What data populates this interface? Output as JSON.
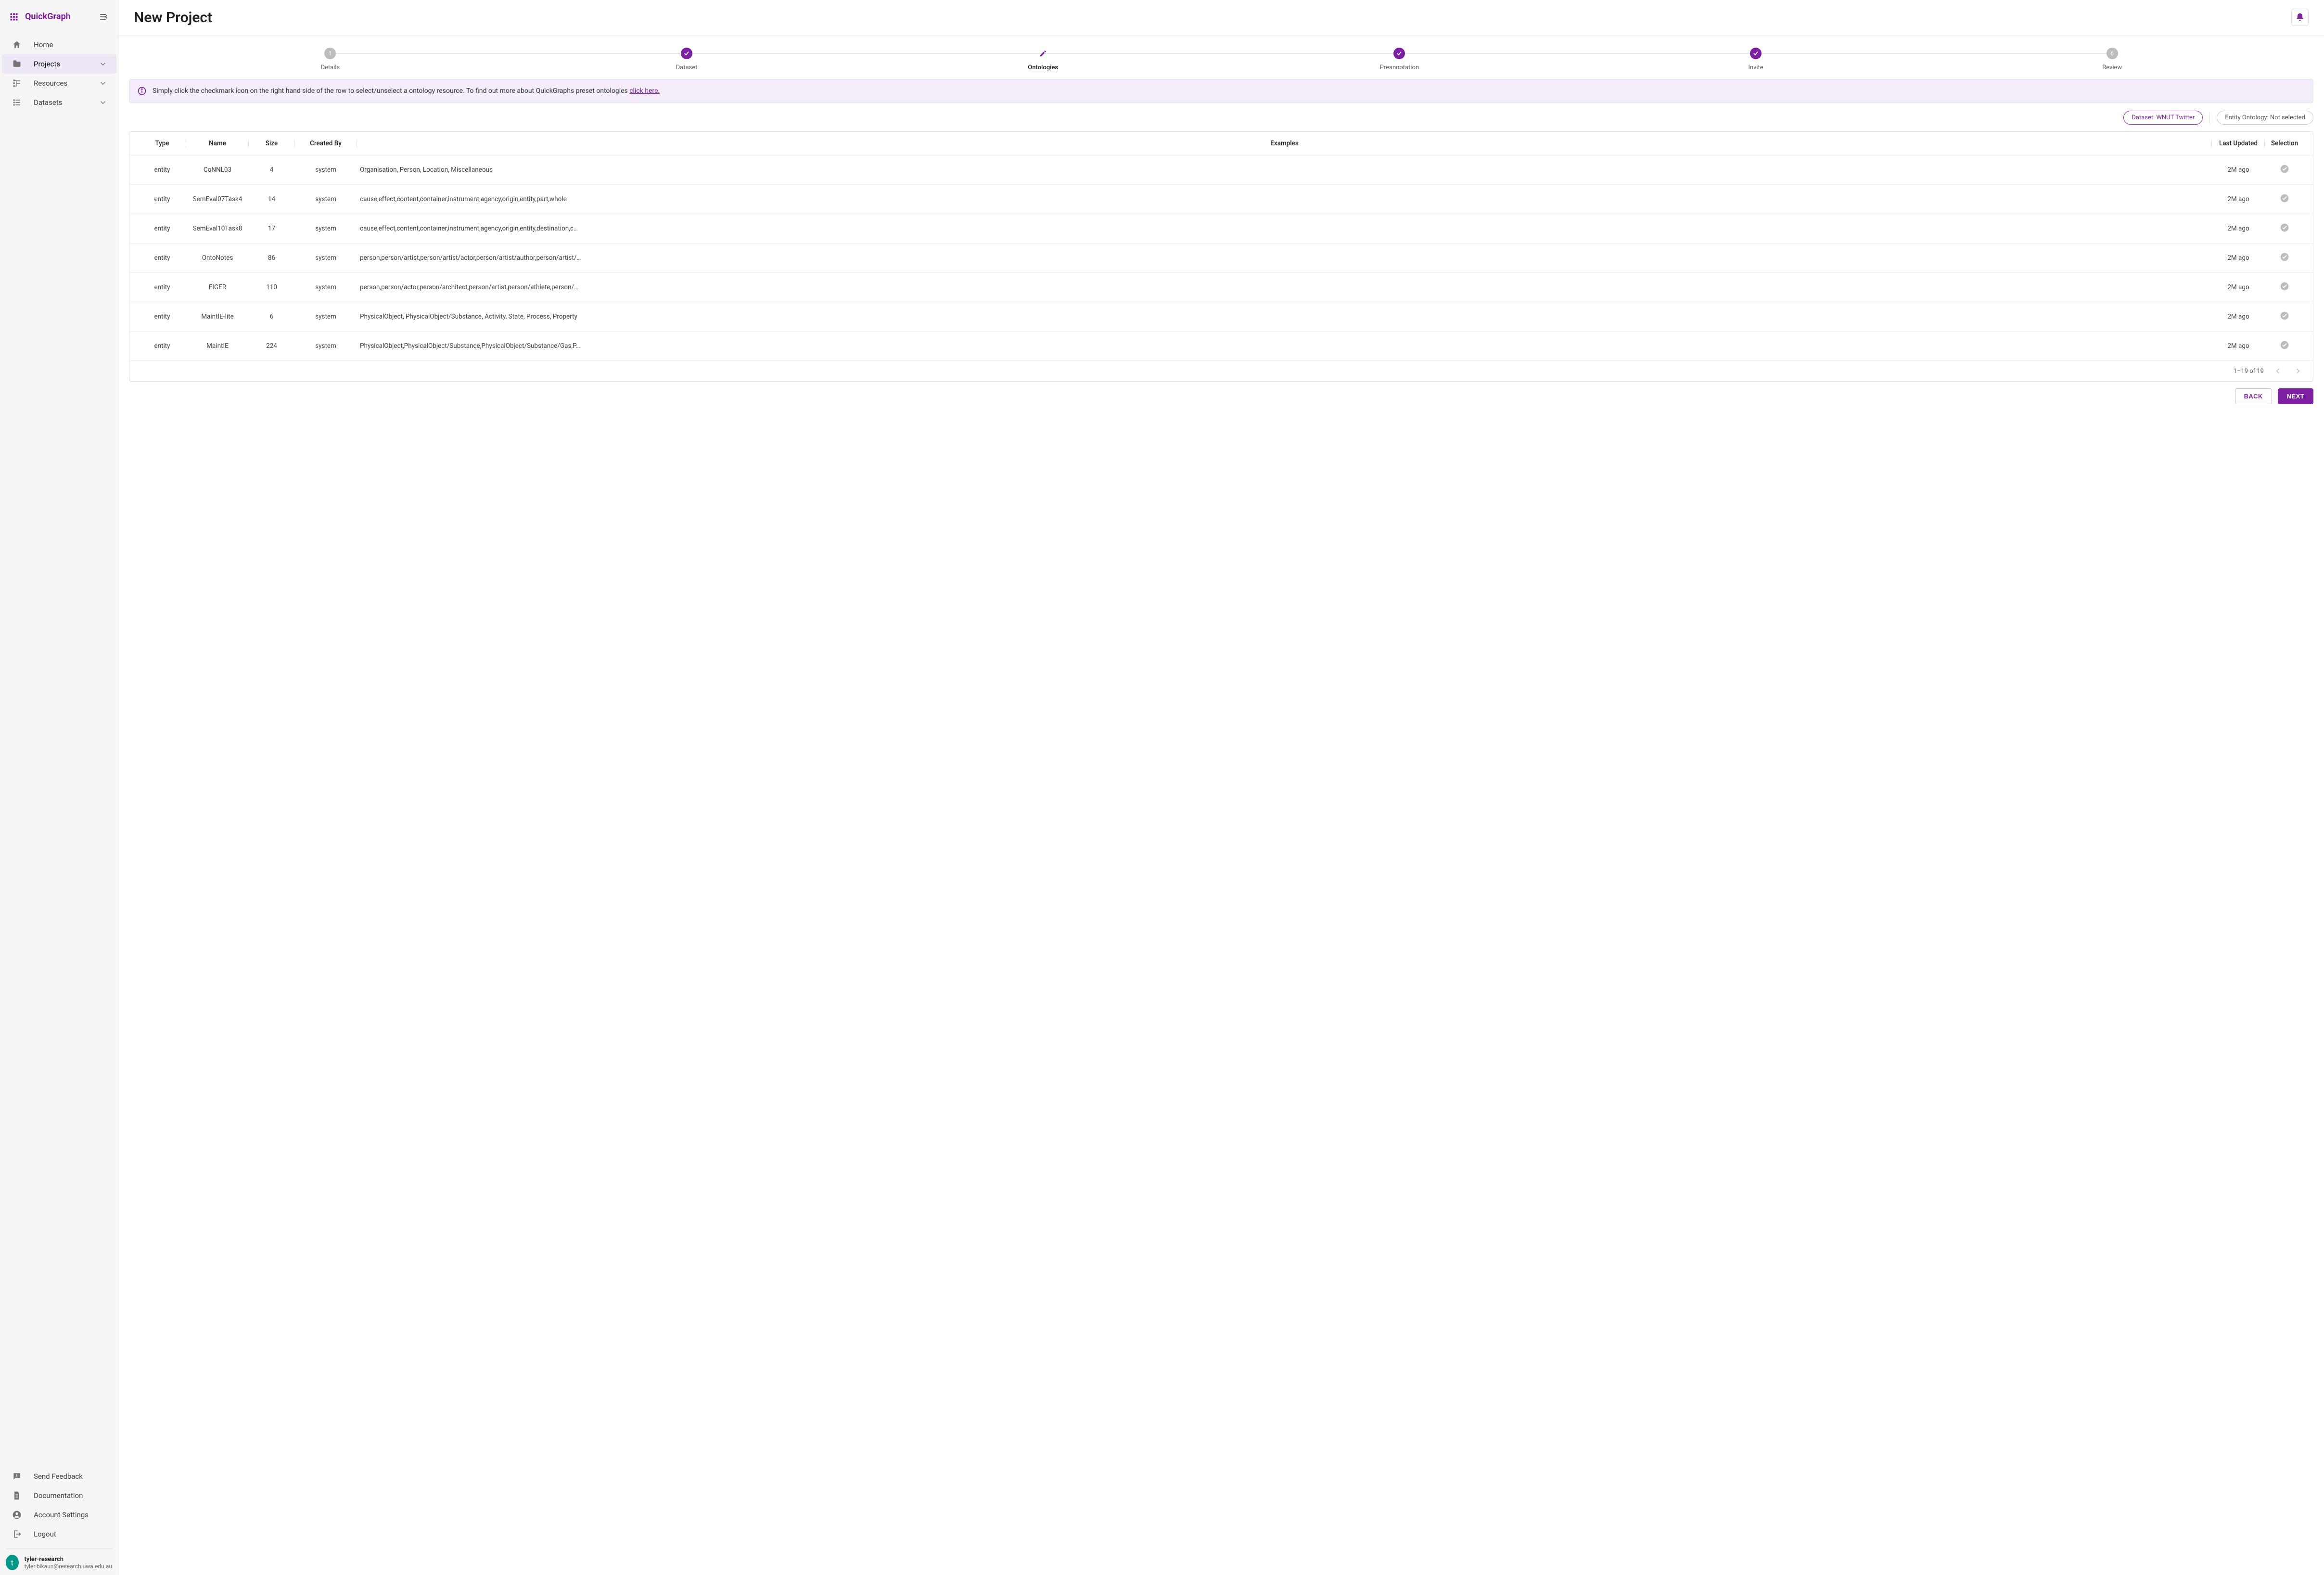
{
  "app": {
    "name": "QuickGraph"
  },
  "sidebar": {
    "items": [
      {
        "label": "Home"
      },
      {
        "label": "Projects"
      },
      {
        "label": "Resources"
      },
      {
        "label": "Datasets"
      }
    ],
    "footer": [
      {
        "label": "Send Feedback"
      },
      {
        "label": "Documentation"
      },
      {
        "label": "Account Settings"
      },
      {
        "label": "Logout"
      }
    ]
  },
  "user": {
    "initial": "t",
    "name": "tyler-research",
    "email": "tyler.bikaun@research.uwa.edu.au"
  },
  "page": {
    "title": "New Project"
  },
  "stepper": [
    {
      "label": "Details",
      "badge": "1"
    },
    {
      "label": "Dataset"
    },
    {
      "label": "Ontologies"
    },
    {
      "label": "Preannotation"
    },
    {
      "label": "Invite"
    },
    {
      "label": "Review",
      "badge": "6"
    }
  ],
  "banner": {
    "text": "Simply click the checkmark icon on the right hand side of the row to select/unselect a ontology resource. To find out more about QuickGraphs preset ontologies ",
    "link_text": "click here."
  },
  "chips": {
    "dataset": "Dataset: WNUT Twitter",
    "entity": "Entity Ontology: Not selected"
  },
  "table": {
    "columns": [
      "Type",
      "Name",
      "Size",
      "Created By",
      "Examples",
      "Last Updated",
      "Selection"
    ],
    "rows": [
      {
        "type": "entity",
        "name": "CoNNL03",
        "size": "4",
        "created_by": "system",
        "examples": "Organisation, Person, Location, Miscellaneous",
        "updated": "2M ago"
      },
      {
        "type": "entity",
        "name": "SemEval07Task4",
        "size": "14",
        "created_by": "system",
        "examples": "cause,effect,content,container,instrument,agency,origin,entity,part,whole",
        "updated": "2M ago"
      },
      {
        "type": "entity",
        "name": "SemEval10Task8",
        "size": "17",
        "created_by": "system",
        "examples": "cause,effect,content,container,instrument,agency,origin,entity,destination,c…",
        "updated": "2M ago"
      },
      {
        "type": "entity",
        "name": "OntoNotes",
        "size": "86",
        "created_by": "system",
        "examples": "person,person/artist,person/artist/actor,person/artist/author,person/artist/…",
        "updated": "2M ago"
      },
      {
        "type": "entity",
        "name": "FIGER",
        "size": "110",
        "created_by": "system",
        "examples": "person,person/actor,person/architect,person/artist,person/athlete,person/…",
        "updated": "2M ago"
      },
      {
        "type": "entity",
        "name": "MaintIE-lite",
        "size": "6",
        "created_by": "system",
        "examples": "PhysicalObject, PhysicalObject/Substance, Activity, State, Process, Property",
        "updated": "2M ago"
      },
      {
        "type": "entity",
        "name": "MaintIE",
        "size": "224",
        "created_by": "system",
        "examples": "PhysicalObject,PhysicalObject/Substance,PhysicalObject/Substance/Gas,P…",
        "updated": "2M ago"
      }
    ],
    "pagination": "1–19 of 19"
  },
  "actions": {
    "back": "BACK",
    "next": "NEXT"
  }
}
